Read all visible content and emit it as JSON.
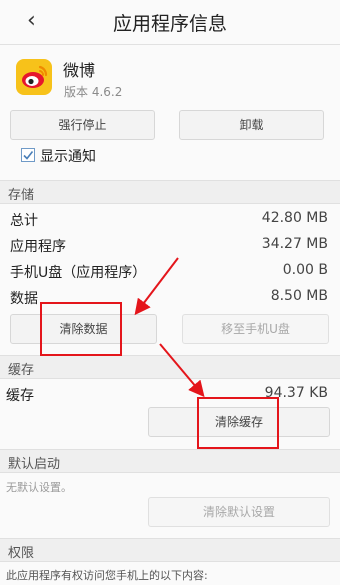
{
  "header": {
    "back_icon": "‹",
    "title": "应用程序信息"
  },
  "app": {
    "name": "微博",
    "version": "版本 4.6.2",
    "icon": "weibo-icon"
  },
  "actions": {
    "force_stop": "强行停止",
    "uninstall": "卸载"
  },
  "notify": {
    "label": "显示通知",
    "checked": true
  },
  "storage": {
    "title": "存储",
    "rows": [
      {
        "label": "总计",
        "value": "42.80 MB"
      },
      {
        "label": "应用程序",
        "value": "34.27 MB"
      },
      {
        "label": "手机U盘（应用程序）",
        "value": "0.00 B"
      },
      {
        "label": "数据",
        "value": "8.50 MB"
      }
    ],
    "clear_data": "清除数据",
    "move_to_phone": "移至手机U盘"
  },
  "cache": {
    "title": "缓存",
    "label": "缓存",
    "value": "94.37 KB",
    "clear_cache": "清除缓存"
  },
  "default_launch": {
    "title": "默认启动",
    "text": "无默认设置。",
    "clear_defaults": "清除默认设置"
  },
  "permissions": {
    "title": "权限",
    "text": "此应用程序有权访问您手机上的以下内容:"
  },
  "colors": {
    "annotation_red": "#e4151b",
    "checkbox_blue": "#6f9ac7",
    "weibo_yellow": "#f7c21a"
  }
}
